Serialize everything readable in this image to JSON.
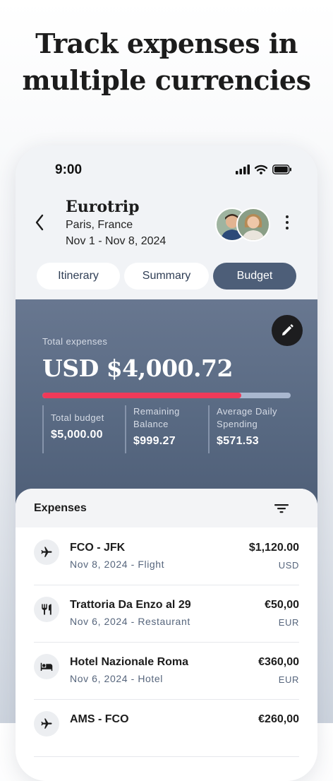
{
  "headline": {
    "line1": "Track expenses in",
    "line2": "multiple currencies"
  },
  "status_bar": {
    "time": "9:00"
  },
  "trip": {
    "title": "Eurotrip",
    "location": "Paris, France",
    "dates": "Nov 1 - Nov 8, 2024"
  },
  "tabs": [
    {
      "label": "Itinerary",
      "active": false
    },
    {
      "label": "Summary",
      "active": false
    },
    {
      "label": "Budget",
      "active": true
    }
  ],
  "budget": {
    "total_label": "Total expenses",
    "total_value": "USD $4,000.72",
    "spent_fraction": 0.8,
    "stats": [
      {
        "label": "Total budget",
        "value": "$5,000.00"
      },
      {
        "label": "Remaining Balance",
        "value": "$999.27"
      },
      {
        "label": "Average Daily Spending",
        "value": "$571.53"
      }
    ]
  },
  "expenses": {
    "title": "Expenses",
    "items": [
      {
        "icon": "airplane-icon",
        "title": "FCO - JFK",
        "subtitle": "Nov 8, 2024 - Flight",
        "amount": "$1,120.00",
        "currency": "USD"
      },
      {
        "icon": "restaurant-icon",
        "title": "Trattoria Da Enzo al 29",
        "subtitle": "Nov 6, 2024 - Restaurant",
        "amount": "€50,00",
        "currency": "EUR"
      },
      {
        "icon": "hotel-bed-icon",
        "title": "Hotel Nazionale Roma",
        "subtitle": "Nov 6, 2024 - Hotel",
        "amount": "€360,00",
        "currency": "EUR"
      },
      {
        "icon": "airplane-icon",
        "title": "AMS - FCO",
        "subtitle": "",
        "amount": "€260,00",
        "currency": ""
      }
    ]
  },
  "colors": {
    "accent": "#4d5e78",
    "progress": "#ef3a59",
    "card": "#586982"
  }
}
